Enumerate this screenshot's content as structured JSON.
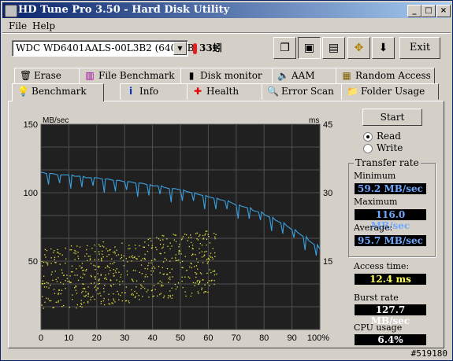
{
  "window": {
    "title": "HD Tune Pro 3.50 - Hard Disk Utility"
  },
  "menu": [
    "File",
    "Help"
  ],
  "toolbar": {
    "drive": "WDC WD6401AALS-00L3B2 (640 GB)",
    "temperature": "33蚓",
    "exit_label": "Exit",
    "icons": [
      "copy-text-icon",
      "copy-screenshot-icon",
      "save-icon",
      "options-icon",
      "download-icon"
    ]
  },
  "tabs_row1": [
    "Erase",
    "File Benchmark",
    "Disk monitor",
    "AAM",
    "Random Access"
  ],
  "tabs_row2": [
    "Benchmark",
    "Info",
    "Health",
    "Error Scan",
    "Folder Usage"
  ],
  "active_tab": "Benchmark",
  "controls": {
    "start": "Start",
    "read": "Read",
    "write": "Write",
    "read_selected": true
  },
  "transfer_rate": {
    "title": "Transfer rate",
    "minimum_label": "Minimum",
    "minimum": "59.2 MB/sec",
    "maximum_label": "Maximum",
    "maximum": "116.0 MB/sec",
    "average_label": "Average:",
    "average": "95.7 MB/sec"
  },
  "access_time": {
    "label": "Access time:",
    "value": "12.4 ms"
  },
  "burst_rate": {
    "label": "Burst rate",
    "value": "127.7 MB/sec"
  },
  "cpu_usage": {
    "label": "CPU usage",
    "value": "6.4%"
  },
  "status_code": "#519180",
  "colors": {
    "transfer_line": "#3aa0e0",
    "access_points": "#e8e840",
    "plot_bg": "#202020",
    "value_blue": "#6fa8ff",
    "value_yellow": "#ffff60",
    "value_white": "#ffffff"
  },
  "chart_data": {
    "type": "line",
    "left_unit": "MB/sec",
    "right_unit": "ms",
    "x_ticks": [
      "0",
      "10",
      "20",
      "30",
      "40",
      "50",
      "60",
      "70",
      "80",
      "90",
      "100%"
    ],
    "y_left_ticks": [
      "150",
      "100",
      "50"
    ],
    "y_right_ticks": [
      "45",
      "30",
      "15"
    ],
    "xlim": [
      0,
      100
    ],
    "ylim_left": [
      0,
      150
    ],
    "ylim_right": [
      0,
      45
    ],
    "grid": true,
    "series": [
      {
        "kind": "transfer_rate_line",
        "x": [
          0,
          2,
          4,
          6,
          8,
          10,
          12,
          14,
          16,
          18,
          20,
          22,
          24,
          26,
          28,
          30,
          32,
          34,
          36,
          38,
          40,
          42,
          44,
          46,
          48,
          50,
          52,
          54,
          56,
          58,
          60,
          62,
          64,
          66,
          68,
          70,
          72,
          74,
          76,
          78,
          80,
          82,
          84,
          86,
          88,
          90,
          92,
          94,
          96,
          98,
          100
        ],
        "y": [
          115,
          114,
          114,
          113,
          113,
          113,
          112,
          112,
          111,
          111,
          111,
          110,
          110,
          109,
          109,
          108,
          108,
          107,
          107,
          106,
          105,
          105,
          104,
          103,
          103,
          102,
          101,
          100,
          99,
          98,
          97,
          96,
          95,
          94,
          93,
          91,
          90,
          89,
          87,
          86,
          84,
          82,
          80,
          78,
          76,
          73,
          71,
          68,
          65,
          62,
          59
        ]
      }
    ],
    "access_time_scatter": {
      "x_range": [
        0,
        63
      ],
      "y_range_ms": [
        4,
        21
      ],
      "mean_ms": 12.4,
      "points": 600
    }
  }
}
